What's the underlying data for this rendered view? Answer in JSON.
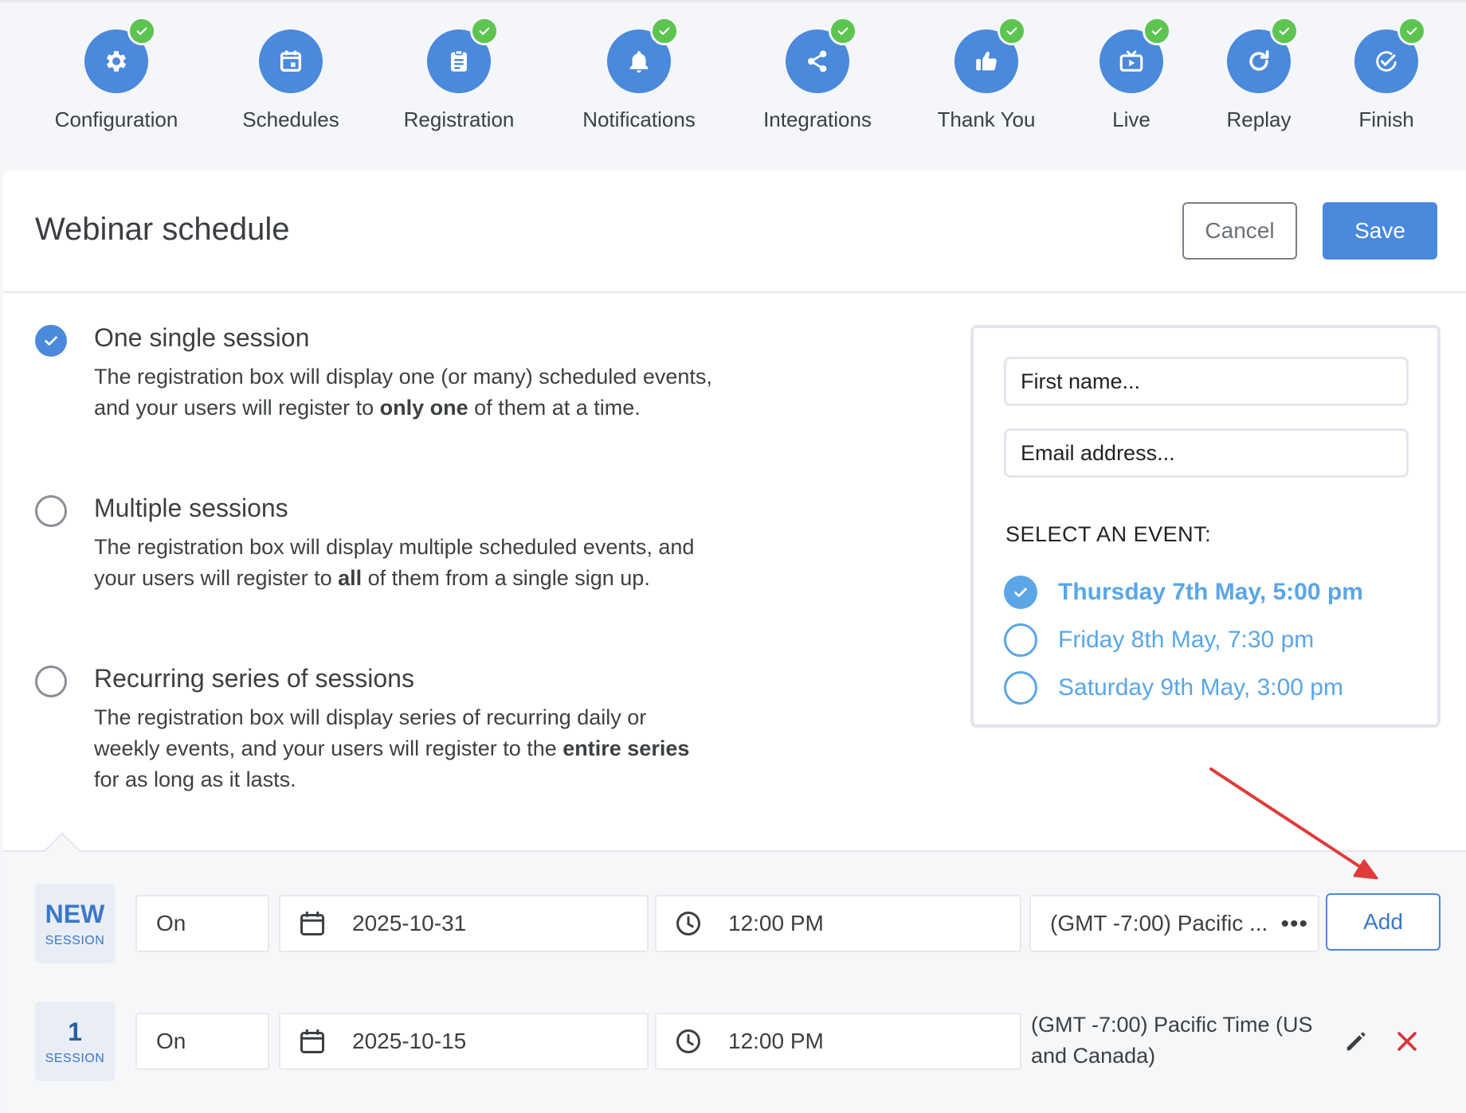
{
  "stepper": {
    "steps": [
      {
        "label": "Configuration",
        "icon": "gear-icon",
        "completed": true
      },
      {
        "label": "Schedules",
        "icon": "calendar-icon",
        "completed": false
      },
      {
        "label": "Registration",
        "icon": "clipboard-icon",
        "completed": true
      },
      {
        "label": "Notifications",
        "icon": "bell-icon",
        "completed": true
      },
      {
        "label": "Integrations",
        "icon": "share-icon",
        "completed": true
      },
      {
        "label": "Thank You",
        "icon": "thumbs-up-icon",
        "completed": true
      },
      {
        "label": "Live",
        "icon": "tv-icon",
        "completed": true
      },
      {
        "label": "Replay",
        "icon": "replay-icon",
        "completed": true
      },
      {
        "label": "Finish",
        "icon": "check-badge-icon",
        "completed": true
      }
    ]
  },
  "header": {
    "title": "Webinar schedule",
    "cancel_label": "Cancel",
    "save_label": "Save"
  },
  "options": [
    {
      "title": "One single session",
      "selected": true,
      "desc_before": "The registration box will display one (or many) scheduled events, and your users will register to ",
      "desc_bold": "only one",
      "desc_after": " of them at a time."
    },
    {
      "title": "Multiple sessions",
      "selected": false,
      "desc_before": "The registration box will display multiple scheduled events, and your users will register to ",
      "desc_bold": "all",
      "desc_after": " of them from a single sign up."
    },
    {
      "title": "Recurring series of sessions",
      "selected": false,
      "desc_before": "The registration box will display series of recurring daily or weekly events, and your users will register to the ",
      "desc_bold": "entire series",
      "desc_after": " for as long as it lasts."
    }
  ],
  "preview": {
    "first_name_placeholder": "First name...",
    "email_placeholder": "Email address...",
    "select_heading": "SELECT AN EVENT:",
    "events": [
      {
        "label": "Thursday 7th May, 5:00 pm",
        "selected": true
      },
      {
        "label": "Friday 8th May, 7:30 pm",
        "selected": false
      },
      {
        "label": "Saturday 9th May, 3:00 pm",
        "selected": false
      }
    ]
  },
  "sessions": {
    "new_row": {
      "badge_main": "NEW",
      "badge_caption": "SESSION",
      "on_label": "On",
      "date": "2025-10-31",
      "time": "12:00 PM",
      "timezone": "(GMT -7:00) Pacific ...",
      "timezone_more": "•••",
      "add_label": "Add"
    },
    "rows": [
      {
        "badge_main": "1",
        "badge_caption": "SESSION",
        "on_label": "On",
        "date": "2025-10-15",
        "time": "12:00 PM",
        "timezone": "(GMT -7:00) Pacific Time (US and Canada)"
      }
    ]
  },
  "colors": {
    "accent": "#4a89dc",
    "check_green": "#5dc44f",
    "event_blue": "#5aa6e6",
    "delete_red": "#d9343a",
    "annotation_arrow": "#e03a3a"
  }
}
